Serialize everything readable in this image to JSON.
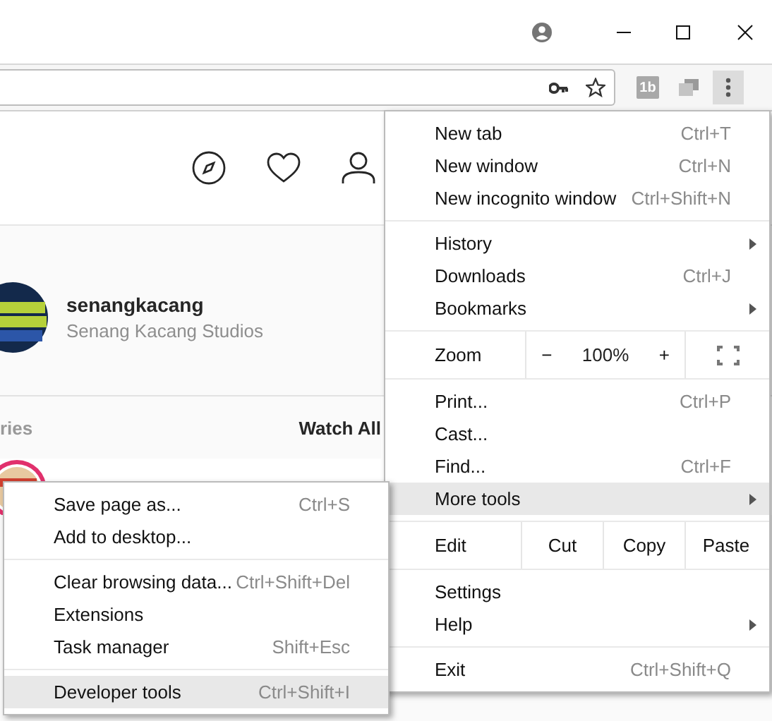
{
  "toolbar": {
    "extension_badge": "1b",
    "menu_button": {
      "selected": true
    }
  },
  "page": {
    "profile": {
      "username": "senangkacang",
      "full_name": "Senang Kacang Studios"
    },
    "stories": {
      "heading": "ries",
      "action": "Watch All"
    }
  },
  "menu": {
    "groups": [
      [
        {
          "kind": "item",
          "label": "New tab",
          "shortcut": "Ctrl+T",
          "submenu": false,
          "selected": false
        },
        {
          "kind": "item",
          "label": "New window",
          "shortcut": "Ctrl+N",
          "submenu": false,
          "selected": false
        },
        {
          "kind": "item",
          "label": "New incognito window",
          "shortcut": "Ctrl+Shift+N",
          "submenu": false,
          "selected": false
        }
      ],
      [
        {
          "kind": "item",
          "label": "History",
          "submenu": true,
          "selected": false
        },
        {
          "kind": "item",
          "label": "Downloads",
          "shortcut": "Ctrl+J",
          "submenu": false,
          "selected": false
        },
        {
          "kind": "item",
          "label": "Bookmarks",
          "submenu": true,
          "selected": false
        }
      ],
      [
        {
          "kind": "zoom",
          "label": "Zoom",
          "minus": "−",
          "value": "100%",
          "plus": "+"
        }
      ],
      [
        {
          "kind": "item",
          "label": "Print...",
          "shortcut": "Ctrl+P",
          "submenu": false,
          "selected": false
        },
        {
          "kind": "item",
          "label": "Cast...",
          "submenu": false,
          "selected": false
        },
        {
          "kind": "item",
          "label": "Find...",
          "shortcut": "Ctrl+F",
          "submenu": false,
          "selected": false
        },
        {
          "kind": "item",
          "label": "More tools",
          "submenu": true,
          "selected": true
        }
      ],
      [
        {
          "kind": "edit",
          "label": "Edit",
          "buttons": [
            "Cut",
            "Copy",
            "Paste"
          ]
        }
      ],
      [
        {
          "kind": "item",
          "label": "Settings",
          "submenu": false,
          "selected": false
        },
        {
          "kind": "item",
          "label": "Help",
          "submenu": true,
          "selected": false
        }
      ],
      [
        {
          "kind": "item",
          "label": "Exit",
          "shortcut": "Ctrl+Shift+Q",
          "submenu": false,
          "selected": false
        }
      ]
    ]
  },
  "submenu": {
    "groups": [
      [
        {
          "label": "Save page as...",
          "shortcut": "Ctrl+S",
          "selected": false
        },
        {
          "label": "Add to desktop...",
          "selected": false
        }
      ],
      [
        {
          "label": "Clear browsing data...",
          "shortcut": "Ctrl+Shift+Del",
          "selected": false
        },
        {
          "label": "Extensions",
          "selected": false
        },
        {
          "label": "Task manager",
          "shortcut": "Shift+Esc",
          "selected": false
        }
      ],
      [
        {
          "label": "Developer tools",
          "shortcut": "Ctrl+Shift+I",
          "selected": true
        }
      ]
    ]
  }
}
